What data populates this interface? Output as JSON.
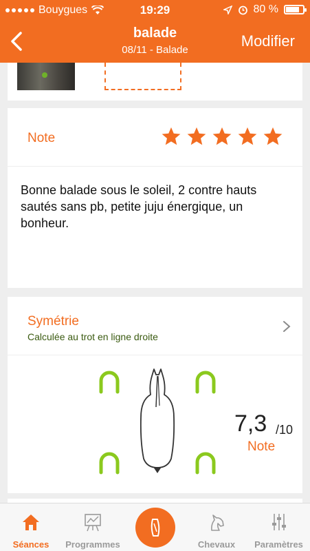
{
  "status": {
    "carrier": "Bouygues",
    "time": "19:29",
    "battery": "80 %",
    "battery_level": 0.8
  },
  "header": {
    "title": "balade",
    "subtitle": "08/11 - Balade",
    "edit_label": "Modifier"
  },
  "note": {
    "label": "Note",
    "rating": 5,
    "rating_max": 5,
    "comment": "Bonne balade sous le soleil, 2 contre hauts sautés sans pb, petite juju énergique, un bonheur."
  },
  "symmetry": {
    "title": "Symétrie",
    "subtitle": "Calculée au trot en ligne droite",
    "score": "7,3",
    "score_max": "/10",
    "score_label": "Note"
  },
  "tabs": [
    {
      "label": "Séances",
      "icon": "home-icon",
      "active": true
    },
    {
      "label": "Programmes",
      "icon": "chart-board-icon",
      "active": false
    },
    {
      "label": "",
      "icon": "record-session-icon",
      "active": false
    },
    {
      "label": "Chevaux",
      "icon": "horse-head-icon",
      "active": false
    },
    {
      "label": "Paramètres",
      "icon": "sliders-icon",
      "active": false
    }
  ],
  "colors": {
    "accent": "#f26d21",
    "shoe": "#8bc91e",
    "background": "#eeeeee"
  }
}
